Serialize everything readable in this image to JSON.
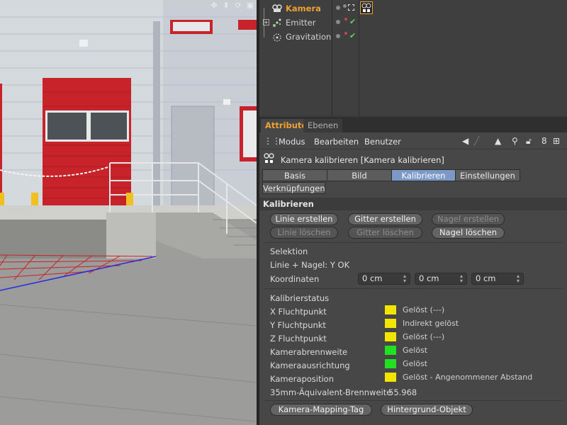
{
  "object_manager": {
    "objects": [
      {
        "name": "Kamera",
        "selected": true,
        "icon": "camera-icon"
      },
      {
        "name": "Emitter",
        "selected": false,
        "icon": "emitter-icon"
      },
      {
        "name": "Gravitation",
        "selected": false,
        "icon": "gravitation-icon"
      }
    ]
  },
  "attribute_manager": {
    "tabs": [
      "Attribute",
      "Ebenen"
    ],
    "menu": [
      "Modus",
      "Bearbeiten",
      "Benutzer"
    ],
    "object_title": "Kamera kalibrieren [Kamera kalibrieren]",
    "property_tabs": [
      "Basis",
      "Bild",
      "Kalibrieren",
      "Einstellungen",
      "Verknüpfungen"
    ],
    "active_property_tab": "Kalibrieren",
    "section_title": "Kalibrieren",
    "buttons_row1": [
      "Linie erstellen",
      "Gitter erstellen",
      "Nagel erstellen"
    ],
    "buttons_row2": [
      "Linie löschen",
      "Gitter löschen",
      "Nagel löschen"
    ],
    "selektion": {
      "heading": "Selektion",
      "info": "Linie + Nagel: Y OK",
      "koordinaten_label": "Koordinaten",
      "koordinaten": [
        "0 cm",
        "0 cm",
        "0 cm"
      ]
    },
    "kalibrierstatus": {
      "heading": "Kalibrierstatus",
      "rows": [
        {
          "label": "X Fluchtpunkt",
          "color": "#f2e600",
          "status": "Gelöst (---)"
        },
        {
          "label": "Y Fluchtpunkt",
          "color": "#f2e600",
          "status": "Indirekt gelöst"
        },
        {
          "label": "Z Fluchtpunkt",
          "color": "#f2e600",
          "status": "Gelöst (---)"
        },
        {
          "label": "Kamerabrennweite",
          "color": "#22e022",
          "status": "Gelöst"
        },
        {
          "label": "Kameraausrichtung",
          "color": "#22e022",
          "status": "Gelöst"
        },
        {
          "label": "Kameraposition",
          "color": "#f2e600",
          "status": "Gelöst - Angenommener Abstand"
        }
      ],
      "focal_label": "35mm-Äquivalent-Brennweite",
      "focal_value": "55.968"
    },
    "bottom_buttons": [
      "Kamera-Mapping-Tag",
      "Hintergrund-Objekt"
    ]
  },
  "colors": {
    "accent_orange": "#f0a030",
    "active_tab_blue": "#7b98c6",
    "door_red": "#c8232a"
  }
}
